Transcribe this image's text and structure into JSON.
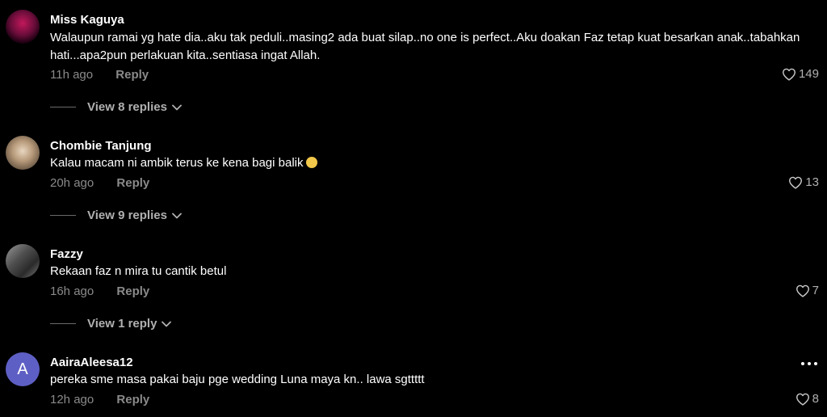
{
  "comments": [
    {
      "username": "Miss Kaguya",
      "text": "Walaupun ramai yg hate dia..aku tak peduli..masing2 ada buat silap..no one is perfect..Aku doakan Faz tetap kuat besarkan anak..tabahkan hati...apa2pun perlakuan kita..sentiasa ingat Allah.",
      "time": "11h ago",
      "reply": "Reply",
      "likes": "149",
      "view_replies": "View 8 replies"
    },
    {
      "username": "Chombie Tanjung",
      "text": "Kalau macam ni ambik terus ke kena bagi balik",
      "time": "20h ago",
      "reply": "Reply",
      "likes": "13",
      "view_replies": "View 9 replies"
    },
    {
      "username": "Fazzy",
      "text": "Rekaan faz n mira tu cantik betul",
      "time": "16h ago",
      "reply": "Reply",
      "likes": "7",
      "view_replies": "View 1 reply"
    },
    {
      "username": "AairaAleesa12",
      "avatar_letter": "A",
      "text": "pereka sme masa pakai baju pge wedding Luna maya kn.. lawa sgttttt",
      "time": "12h ago",
      "reply": "Reply",
      "likes": "8"
    }
  ],
  "icons": {
    "like": "heart-outline-icon",
    "expand": "chevron-down-icon",
    "more": "more-horizontal-icon"
  },
  "colors": {
    "background": "#000000",
    "text": "#ffffff",
    "muted": "#8a8a8a",
    "avatar_default": "#5e5fc4"
  }
}
